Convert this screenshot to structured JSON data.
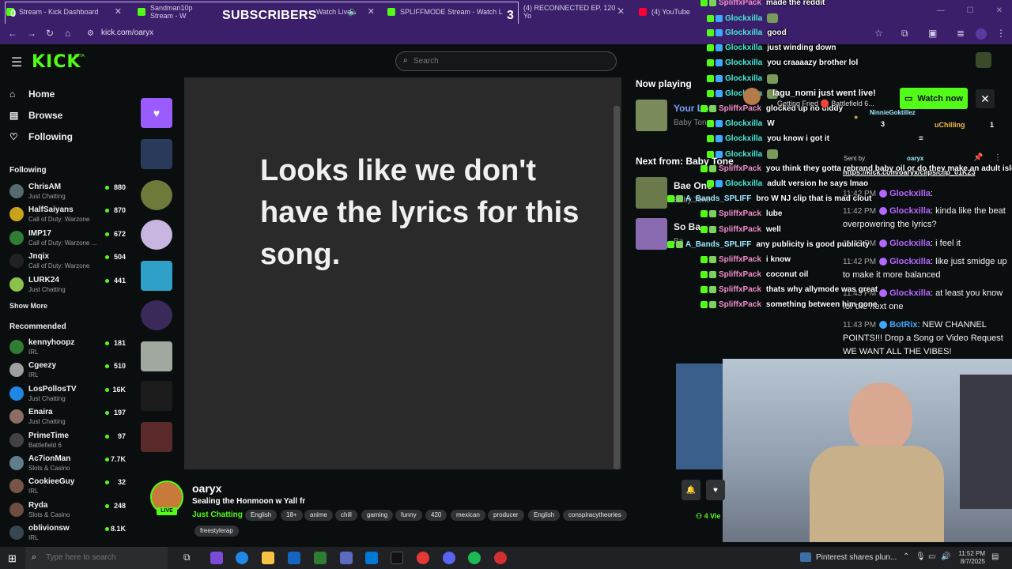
{
  "browser": {
    "tabs": [
      {
        "title": "Stream - Kick Dashboard",
        "favicon_color": "#53fc18"
      },
      {
        "title": "Sandman10p Stream - W",
        "favicon_color": "#53fc18"
      },
      {
        "title": "Watch Live",
        "favicon_color": "#53fc18"
      },
      {
        "title": "SPLIFFMODE Stream - Watch L",
        "favicon_color": "#53fc18"
      },
      {
        "title": "(4) RECONNECTED EP. 120 - Yo",
        "favicon_color": "#ff0033"
      },
      {
        "title": "(4) YouTube",
        "favicon_color": "#ff0033"
      }
    ],
    "overlay_label": "SUBSCRIBERS",
    "overlay_count": "3",
    "url": "kick.com/oaryx"
  },
  "header": {
    "logo": "KICK",
    "beta": "BETA",
    "search_placeholder": "Search"
  },
  "sidebar": {
    "nav": [
      {
        "label": "Home",
        "icon": "home-icon"
      },
      {
        "label": "Browse",
        "icon": "browse-icon"
      },
      {
        "label": "Following",
        "icon": "heart-icon"
      }
    ],
    "following_heading": "Following",
    "following": [
      {
        "name": "ChrisAM",
        "category": "Just Chatting",
        "viewers": "880",
        "color": "#556b6f"
      },
      {
        "name": "HalfSaiyans",
        "category": "Call of Duty: Warzone",
        "viewers": "870",
        "color": "#c9a21a"
      },
      {
        "name": "IMP17",
        "category": "Call of Duty: Warzone ...",
        "viewers": "672",
        "color": "#2e7d32"
      },
      {
        "name": "Jnqix",
        "category": "Call of Duty: Warzone",
        "viewers": "504",
        "color": "#222222"
      },
      {
        "name": "LURK24",
        "category": "Just Chatting",
        "viewers": "441",
        "color": "#8bc34a"
      }
    ],
    "show_more": "Show More",
    "recommended_heading": "Recommended",
    "recommended": [
      {
        "name": "kennyhoopz",
        "category": "IRL",
        "viewers": "181",
        "color": "#2e7d32"
      },
      {
        "name": "Cgeezy",
        "category": "IRL",
        "viewers": "510",
        "color": "#9e9e9e"
      },
      {
        "name": "LosPollosTV",
        "category": "Just Chatting",
        "viewers": "16K",
        "color": "#1e88e5"
      },
      {
        "name": "Enaira",
        "category": "Just Chatting",
        "viewers": "197",
        "color": "#8d6e63"
      },
      {
        "name": "PrimeTime",
        "category": "Battlefield 6",
        "viewers": "97",
        "color": "#424242"
      },
      {
        "name": "Ac7ionMan",
        "category": "Slots & Casino",
        "viewers": "7.7K",
        "color": "#607d8b"
      },
      {
        "name": "CookieeGuy",
        "category": "IRL",
        "viewers": "32",
        "color": "#795548"
      },
      {
        "name": "Ryda",
        "category": "Slots & Casino",
        "viewers": "248",
        "color": "#6d4c41"
      },
      {
        "name": "oblivionsw",
        "category": "IRL",
        "viewers": "8.1K",
        "color": "#37474f"
      }
    ]
  },
  "player": {
    "lyrics_message": "Looks like we don't have the lyrics for this song."
  },
  "now_playing": {
    "heading": "Now playing",
    "current": {
      "song": "Your Lo",
      "artist": "Baby Tone"
    },
    "next_heading": "Next from: Baby Tone",
    "next": [
      {
        "song": "Bae One",
        "artist": "Baby Tone"
      },
      {
        "song": "So Ba",
        "artist": "Ba"
      }
    ]
  },
  "overlay_chat": [
    {
      "user": "SpliffxPack",
      "text": "made the reddit",
      "style": "spliff"
    },
    {
      "user": "Glockxilla",
      "text": "",
      "style": "glock",
      "emote": true
    },
    {
      "user": "Glockxilla",
      "text": "good",
      "style": "glock"
    },
    {
      "user": "Glockxilla",
      "text": "just winding down",
      "style": "glock"
    },
    {
      "user": "Glockxilla",
      "text": "you craaaazy brother lol",
      "style": "glock"
    },
    {
      "user": "Glockxilla",
      "text": "",
      "style": "glock",
      "emote": true
    },
    {
      "user": "Glockxilla",
      "text": "",
      "style": "glock",
      "emote": true
    },
    {
      "user": "SpliffxPack",
      "text": "glocked up no diddy",
      "style": "spliff"
    },
    {
      "user": "Glockxilla",
      "text": "W",
      "style": "glock"
    },
    {
      "user": "Glockxilla",
      "text": "you know i got it",
      "style": "glock"
    },
    {
      "user": "Glockxilla",
      "text": "",
      "style": "glock",
      "emote": true
    },
    {
      "user": "SpliffxPack",
      "text": "you think they gotta rebrand baby oil or do they make an adult isle ver",
      "style": "spliff"
    },
    {
      "user": "Glockxilla",
      "text": "adult version he says lmao",
      "style": "glock"
    },
    {
      "user": "A_Bands_SPLIFF",
      "text": "bro W NJ clip that is mad clout",
      "style": "bands"
    },
    {
      "user": "SpliffxPack",
      "text": "lube",
      "style": "spliff"
    },
    {
      "user": "SpliffxPack",
      "text": "well",
      "style": "spliff"
    },
    {
      "user": "A_Bands_SPLIFF",
      "text": "any publicity is good publicity",
      "style": "bands"
    },
    {
      "user": "SpliffxPack",
      "text": "i know",
      "style": "spliff"
    },
    {
      "user": "SpliffxPack",
      "text": "coconut oil",
      "style": "spliff"
    },
    {
      "user": "SpliffxPack",
      "text": "thats why allymode was great",
      "style": "spliff"
    },
    {
      "user": "SpliffxPack",
      "text": "something between him gone",
      "style": "spliff"
    }
  ],
  "live_popup": {
    "text": "lagu_nomi just went live!",
    "sub": "Getting Fried 🛑 Battlefield 6...",
    "watch_label": "Watch now"
  },
  "leaderboard": {
    "left_name": "NinnieGoktillez",
    "left_count": "3",
    "right_name": "uChilling",
    "right_count": "1"
  },
  "pinned": {
    "sent_by": "Sent by",
    "user": "oaryx",
    "link": "https://kick.com/oaryx/clips/clip_01K23"
  },
  "right_chat": [
    {
      "time": "11:42 PM",
      "user": "Glockxilla",
      "text": ""
    },
    {
      "time": "11:42 PM",
      "user": "Glockxilla",
      "text": "kinda like the beat overpowering the lyrics?"
    },
    {
      "time": "11:42 PM",
      "user": "Glockxilla",
      "text": "i feel it"
    },
    {
      "time": "11:42 PM",
      "user": "Glockxilla",
      "text": "like just smidge up to make it more balanced"
    },
    {
      "time": "11:43 PM",
      "user": "Glockxilla",
      "text": "at least you know for the next one"
    },
    {
      "time": "11:43 PM",
      "user": "BotRix",
      "text": "NEW CHANNEL POINTS!!! Drop a Song or Video Request WE WANT ALL THE VIBES!"
    }
  ],
  "channel": {
    "name": "oaryx",
    "live": "LIVE",
    "title": "Sealing the Honmoon w Yall fr",
    "category": "Just Chatting",
    "tags": [
      "English",
      "18+",
      "anime",
      "chill",
      "gaming",
      "funny",
      "420",
      "mexican",
      "producer",
      "English",
      "conspiracytheories",
      "freestylerap"
    ],
    "viewers": "4 Vie"
  },
  "taskbar": {
    "search_placeholder": "Type here to search",
    "news": "Pinterest shares plun...",
    "time": "11:52 PM",
    "date": "8/7/2025"
  }
}
